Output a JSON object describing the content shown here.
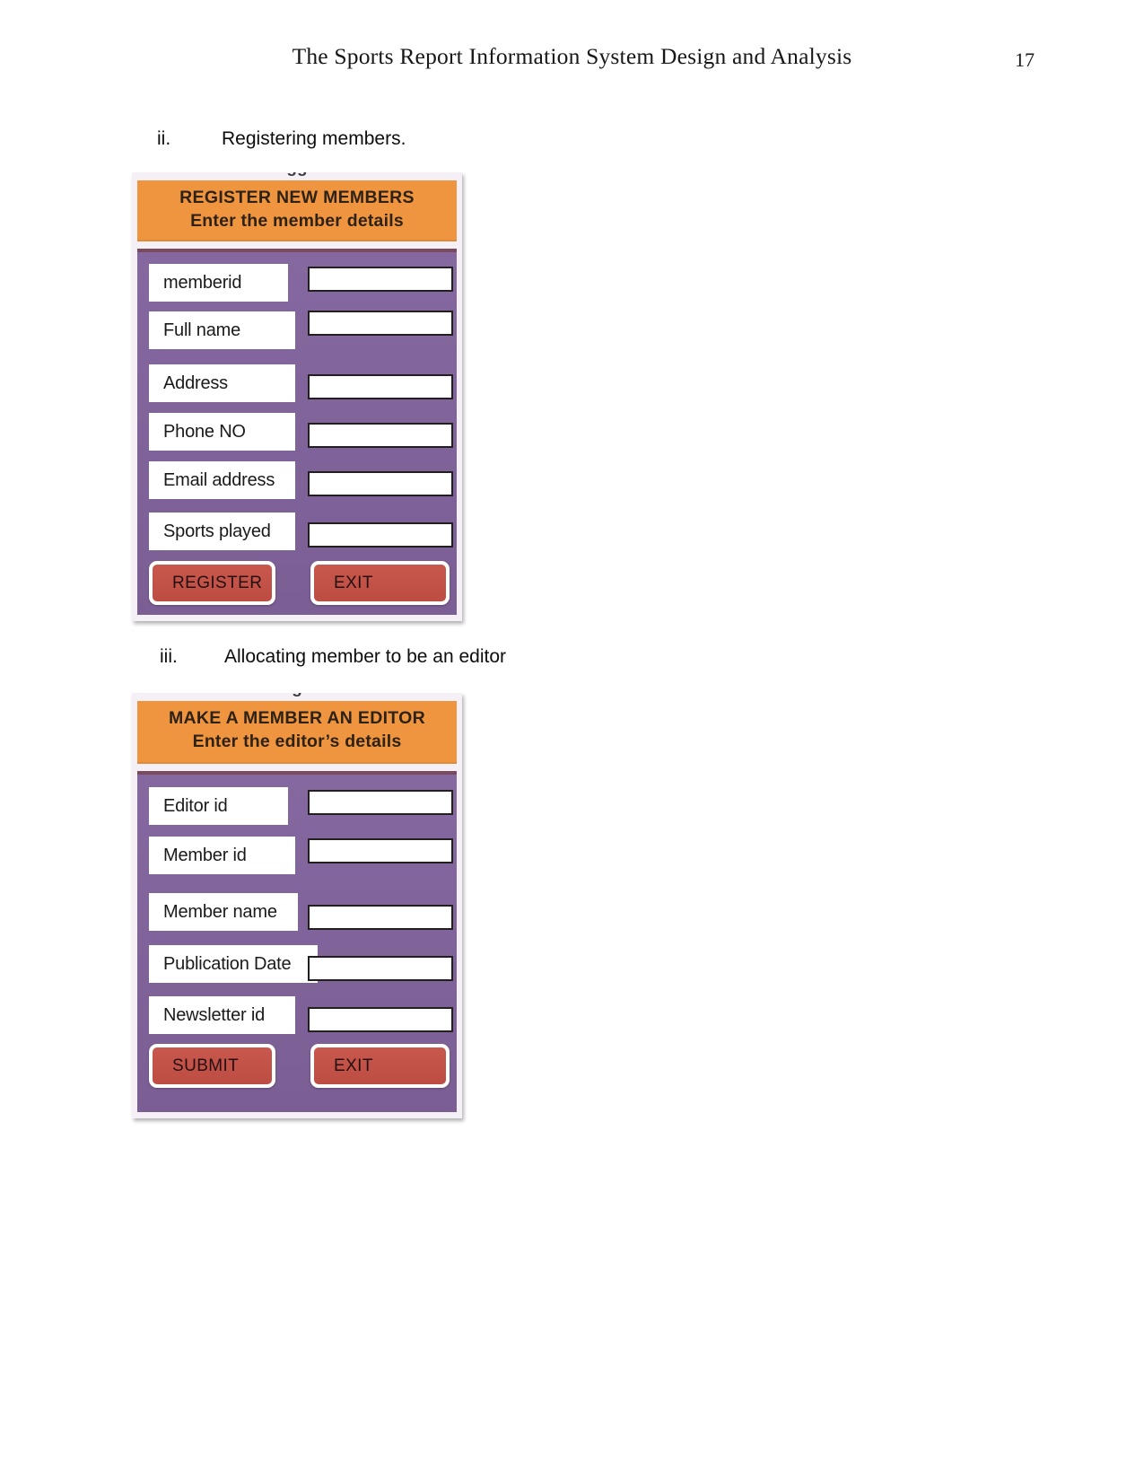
{
  "header": {
    "title": "The Sports Report Information System Design and Analysis",
    "page_number": "17"
  },
  "sections": [
    {
      "numeral": "ii.",
      "text": "Registering members."
    },
    {
      "numeral": "iii.",
      "text": "Allocating member to be an editor"
    }
  ],
  "colors": {
    "header_orange": "#f0953f",
    "body_purple": "#7f6399",
    "button_red": "#c4544a",
    "dialog_frame": "#f4f0f6",
    "input_border": "#231f20"
  },
  "forms": [
    {
      "ghost_text": "gg",
      "title": "REGISTER NEW MEMBERS",
      "subtitle": "Enter the member details",
      "fields": [
        {
          "label": "memberid",
          "value": ""
        },
        {
          "label": "Full name",
          "value": ""
        },
        {
          "label": "Address",
          "value": ""
        },
        {
          "label": "Phone NO",
          "value": ""
        },
        {
          "label": "Email address",
          "value": ""
        },
        {
          "label": "Sports played",
          "value": ""
        }
      ],
      "buttons": [
        {
          "label": "REGISTER"
        },
        {
          "label": "EXIT"
        }
      ]
    },
    {
      "ghost_text": "g",
      "title": "MAKE A MEMBER AN EDITOR",
      "subtitle": "Enter the editor’s details",
      "fields": [
        {
          "label": "Editor id",
          "value": ""
        },
        {
          "label": "Member id",
          "value": ""
        },
        {
          "label": "Member name",
          "value": ""
        },
        {
          "label": "Publication Date",
          "value": ""
        },
        {
          "label": "Newsletter id",
          "value": ""
        }
      ],
      "buttons": [
        {
          "label": "SUBMIT"
        },
        {
          "label": "EXIT"
        }
      ]
    }
  ]
}
